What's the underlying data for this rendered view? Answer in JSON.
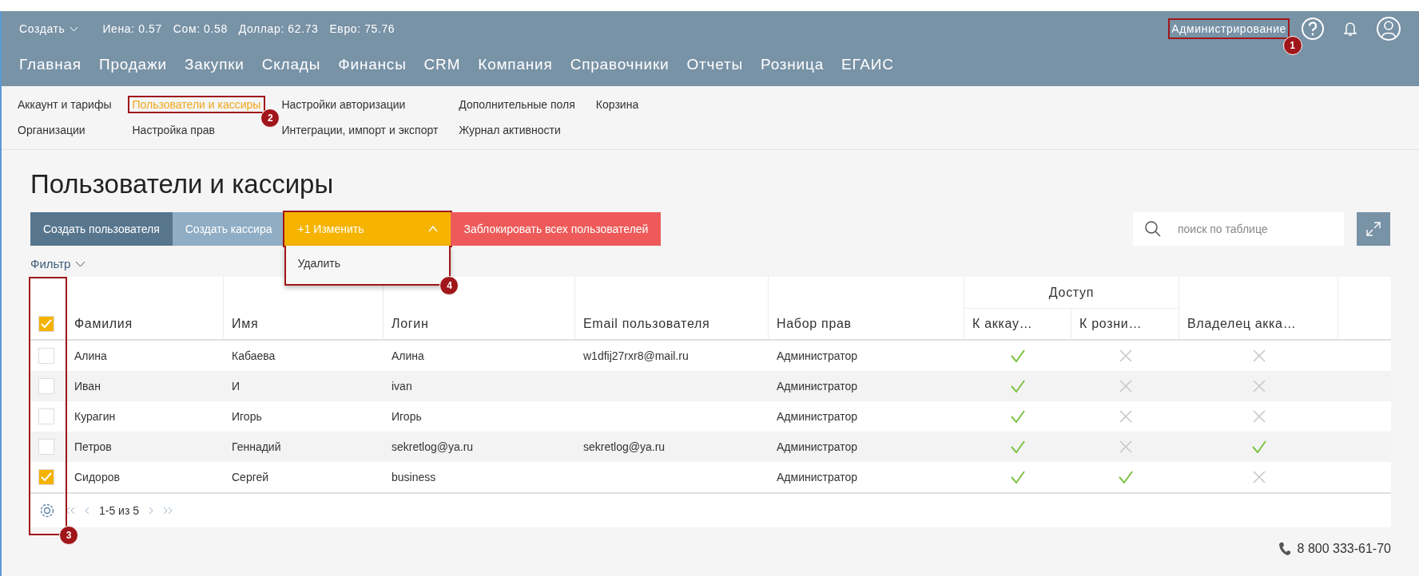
{
  "top_bar": {
    "create_menu": "Создать",
    "rates": [
      "Иена: 0.57",
      "Сом: 0.58",
      "Доллар: 62.73",
      "Евро: 75.76"
    ],
    "admin_link": {
      "label": "Администрирование",
      "callout": "1"
    }
  },
  "nav": [
    "Главная",
    "Продажи",
    "Закупки",
    "Склады",
    "Финансы",
    "CRM",
    "Компания",
    "Справочники",
    "Отчеты",
    "Розница",
    "ЕГАИС"
  ],
  "subnav": [
    {
      "label": "Аккаунт и тарифы",
      "selected": false
    },
    {
      "label": "Пользователи и кассиры",
      "selected": true,
      "callout": "2"
    },
    {
      "label": "Настройки авторизации",
      "selected": false
    },
    {
      "label": "Дополнительные поля",
      "selected": false
    },
    {
      "label": "Корзина",
      "selected": false
    },
    {
      "label": "Организации",
      "selected": false
    },
    {
      "label": "Настройка прав",
      "selected": false
    },
    {
      "label": "Интеграции, импорт и экспорт",
      "selected": false
    },
    {
      "label": "Журнал активности",
      "selected": false
    }
  ],
  "page_title": "Пользователи и кассиры",
  "toolbar": [
    {
      "kind": "primary",
      "label": "Создать пользователя"
    },
    {
      "kind": "secondary",
      "label": "Создать кассира"
    },
    {
      "kind": "edit",
      "count": "+1",
      "label": "Изменить",
      "expanded": true,
      "menu": [
        "Удалить"
      ],
      "callout": "4"
    },
    {
      "kind": "danger",
      "label": "Заблокировать всех пользователей"
    }
  ],
  "search": {
    "placeholder": "поиск по таблице"
  },
  "filter": "Фильтр",
  "table": {
    "all_checked": true,
    "checkbox_callout": "3",
    "columns": [
      "Фамилия",
      "Имя",
      "Логин",
      "Email пользователя",
      "Набор прав"
    ],
    "group_header": "Доступ",
    "group_columns": [
      "К аккау…",
      "К розни…"
    ],
    "owner_column": "Владелец акка…",
    "rows": [
      {
        "checked": false,
        "cells": [
          "Алина",
          "Кабаева",
          "Алина",
          "w1dfij27rxr8@mail.ru",
          "Администратор"
        ],
        "account": true,
        "retail": false,
        "owner": false
      },
      {
        "checked": false,
        "cells": [
          "Иван",
          "И",
          "ivan",
          "",
          "Администратор"
        ],
        "account": true,
        "retail": false,
        "owner": false
      },
      {
        "checked": false,
        "cells": [
          "Курагин",
          "Игорь",
          "Игорь",
          "",
          "Администратор"
        ],
        "account": true,
        "retail": false,
        "owner": false
      },
      {
        "checked": false,
        "cells": [
          "Петров",
          "Геннадий",
          "sekretlog@ya.ru",
          "sekretlog@ya.ru",
          "Администратор"
        ],
        "account": true,
        "retail": false,
        "owner": true
      },
      {
        "checked": true,
        "cells": [
          "Сидоров",
          "Сергей",
          "business",
          "",
          "Администратор"
        ],
        "account": true,
        "retail": true,
        "owner": false
      }
    ]
  },
  "pagination": {
    "range": "1-5 из 5"
  },
  "phone": "8 800 333-61-70"
}
